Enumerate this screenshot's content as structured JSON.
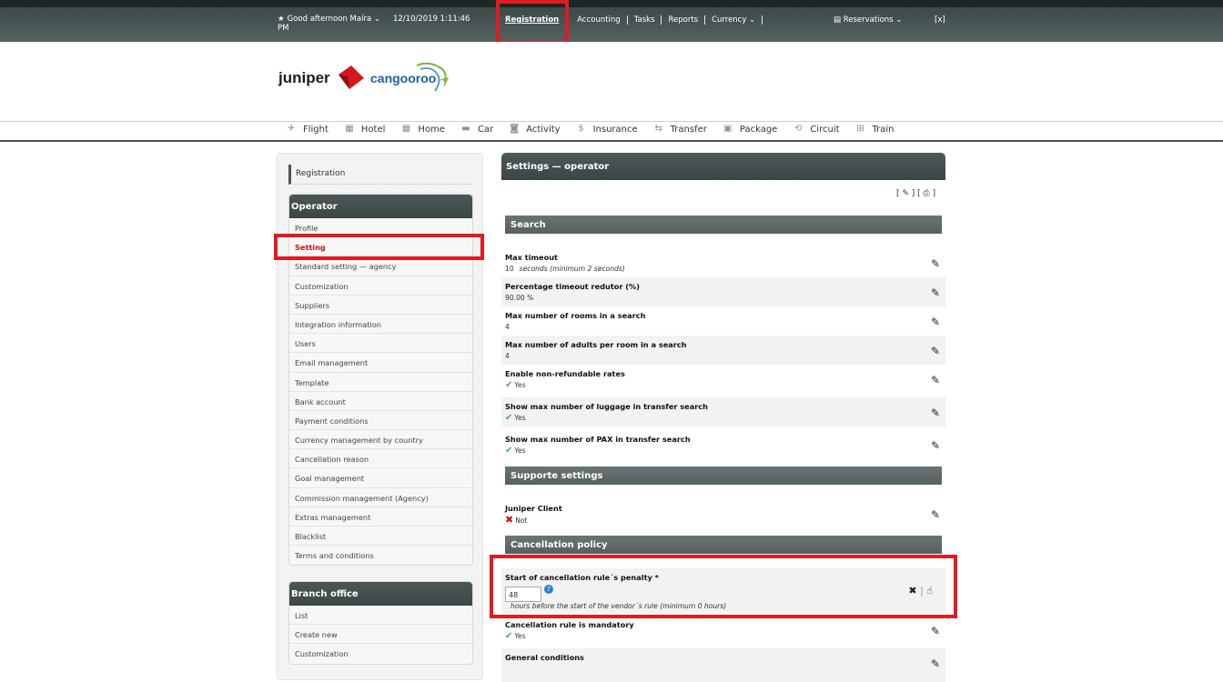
{
  "topbar": {
    "greeting": "Good afternoon Maíra",
    "datetime": "12/10/2019 1:11:46",
    "pm": "PM",
    "nav": [
      "Registration",
      "Accounting",
      "Tasks",
      "Reports",
      "Currency"
    ],
    "reservations": "Reservations",
    "close": "[x]"
  },
  "logo": {
    "brand1": "juniper",
    "brand2": "cangooroo"
  },
  "products": [
    "Flight",
    "Hotel",
    "Home",
    "Car",
    "Activity",
    "Insurance",
    "Transfer",
    "Package",
    "Circuit",
    "Train"
  ],
  "sidebar": {
    "breadcrumb": "Registration",
    "operator": {
      "title": "Operator",
      "items": [
        "Profile",
        "Setting",
        "Standard setting — agency",
        "Customization",
        "Suppliers",
        "Integration information",
        "Users",
        "Email management",
        "Template",
        "Bank account",
        "Payment conditions",
        "Currency management by country",
        "Cancellation reason",
        "Goal management",
        "Commission management (Agency)",
        "Extras management",
        "Blacklist",
        "Terms and conditions"
      ]
    },
    "branch": {
      "title": "Branch office",
      "items": [
        "List",
        "Create new",
        "Customization"
      ]
    }
  },
  "main": {
    "title": "Settings — operator",
    "sections": {
      "search": "Search",
      "support": "Supporte settings",
      "cancellation": "Cancellation policy"
    },
    "rows": {
      "max_timeout": {
        "label": "Max timeout",
        "value": "10",
        "note": "seconds (minimum 2 seconds)"
      },
      "pct_timeout": {
        "label": "Percentage timeout redutor (%)",
        "value": "90.00  %"
      },
      "max_rooms": {
        "label": "Max number of rooms in a search",
        "value": "4"
      },
      "max_adults": {
        "label": "Max number of adults per room in a search",
        "value": "4"
      },
      "nonrefundable": {
        "label": "Enable non-refundable rates",
        "value": "Yes"
      },
      "luggage": {
        "label": "Show max number of luggage in transfer search",
        "value": "Yes"
      },
      "pax": {
        "label": "Show max number of PAX in transfer search",
        "value": "Yes"
      },
      "juniper_client": {
        "label": "Juniper Client",
        "value": "Not"
      },
      "penalty": {
        "label": "Start of cancellation rule´s penalty *",
        "input": "48",
        "note": "hours before the start of the vendor´s rule (minimum 0 hours)"
      },
      "mandatory": {
        "label": "Cancellation rule is mandatory",
        "value": "Yes"
      },
      "general": {
        "label": "General conditions"
      }
    }
  },
  "colors": {
    "header": "#4a5656",
    "highlight": "#e11b22",
    "active_link": "#c8161d"
  },
  "icons": [
    "pencil-icon",
    "print-icon",
    "check-icon",
    "cross-icon",
    "info-icon",
    "close-icon",
    "hand-pointer-icon",
    "star-icon"
  ]
}
